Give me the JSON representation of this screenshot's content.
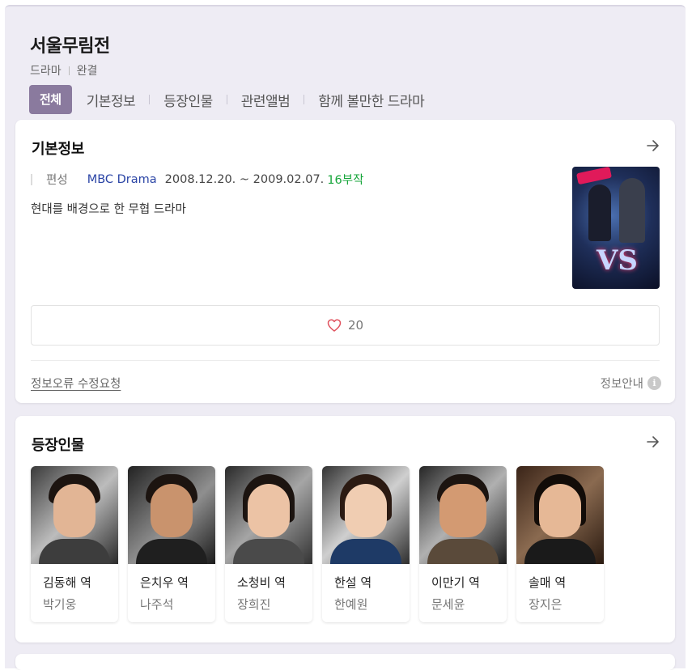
{
  "header": {
    "title": "서울무림전",
    "genre": "드라마",
    "status": "완결",
    "tabs": [
      "전체",
      "기본정보",
      "등장인물",
      "관련앨범",
      "함께 볼만한 드라마"
    ]
  },
  "basic_info": {
    "section_title": "기본정보",
    "label": "편성",
    "channel": "MBC Drama",
    "period": "2008.12.20. ~ 2009.02.07.",
    "episodes": "16부작",
    "description": "현대를 배경으로 한 무협 드라마",
    "like_count": "20",
    "report_link": "정보오류 수정요청",
    "info_guide": "정보안내",
    "icons": {
      "arrow": "arrow-right-icon",
      "heart": "heart-outline-icon",
      "info": "info-circle-icon"
    }
  },
  "characters": {
    "section_title": "등장인물",
    "items": [
      {
        "role": "김동해 역",
        "actor": "박기웅"
      },
      {
        "role": "은치우 역",
        "actor": "나주석"
      },
      {
        "role": "소청비 역",
        "actor": "장희진"
      },
      {
        "role": "한설 역",
        "actor": "한예원"
      },
      {
        "role": "이만기 역",
        "actor": "문세윤"
      },
      {
        "role": "솔매 역",
        "actor": "장지은"
      }
    ]
  },
  "colors": {
    "accent_tab": "#8a7a9e",
    "channel_link": "#2a44a5",
    "episodes": "#16a53a",
    "page_bg": "#eeecf4"
  }
}
